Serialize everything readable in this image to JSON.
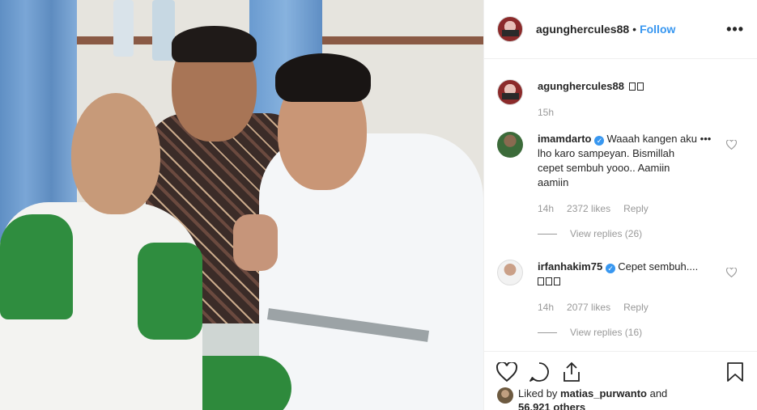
{
  "post": {
    "owner": {
      "username": "agunghercules88",
      "follow_label": "Follow",
      "separator": "•"
    },
    "more_label": "•••",
    "caption": {
      "username": "agunghercules88",
      "time": "15h"
    },
    "comments": [
      {
        "username": "imamdarto",
        "verified": true,
        "text_lines": [
          "Waaah kangen aku",
          "lho karo sampeyan. Bismillah",
          "cepet sembuh yooo.. Aamiin",
          "aamiin"
        ],
        "time": "14h",
        "likes": "2372 likes",
        "reply_label": "Reply",
        "view_replies": "View replies (26)",
        "more": "•••"
      },
      {
        "username": "irfanhakim75",
        "verified": true,
        "text_lines": [
          "Cepet sembuh...."
        ],
        "time": "14h",
        "likes": "2077 likes",
        "reply_label": "Reply",
        "view_replies": "View replies (16)"
      }
    ],
    "liked_by": {
      "prefix": "Liked by",
      "user": "matias_purwanto",
      "and": "and",
      "others": "56,921 others"
    },
    "icons": {
      "like": "heart-icon",
      "comment": "comment-icon",
      "share": "share-icon",
      "save": "bookmark-icon",
      "comment_like": "small-heart-icon",
      "verified": "verified-badge-icon"
    },
    "colors": {
      "link_blue": "#3897f0",
      "muted": "#999999",
      "text": "#262626"
    }
  }
}
